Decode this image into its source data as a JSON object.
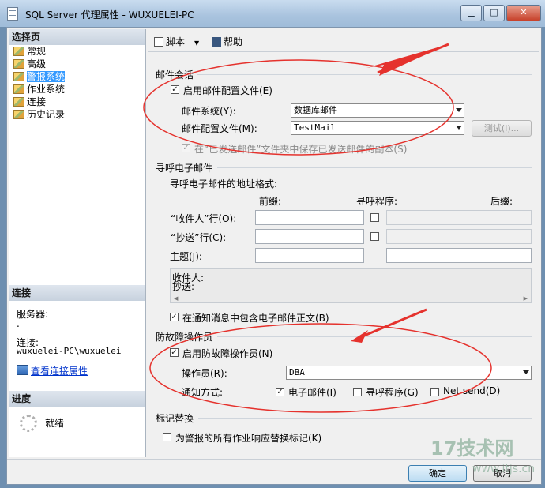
{
  "window": {
    "title": "SQL Server 代理属性 - WUXUELEI-PC",
    "minimize": "▁",
    "maximize": "□",
    "close": "✕"
  },
  "left": {
    "select_page_header": "选择页",
    "pages": [
      {
        "label": "常规"
      },
      {
        "label": "高级"
      },
      {
        "label": "警报系统"
      },
      {
        "label": "作业系统"
      },
      {
        "label": "连接"
      },
      {
        "label": "历史记录"
      }
    ],
    "connection_header": "连接",
    "server_label": "服务器:",
    "server_value": ".",
    "connection_label": "连接:",
    "connection_value": "wuxuelei-PC\\wuxuelei",
    "view_link": "查看连接属性",
    "progress_header": "进度",
    "status": "就绪"
  },
  "toolbar": {
    "script_label": "脚本",
    "help_label": "帮助"
  },
  "mail": {
    "section": "邮件会话",
    "enable_profile": "启用邮件配置文件(E)",
    "system_label": "邮件系统(Y):",
    "system_value": "数据库邮件",
    "profile_label": "邮件配置文件(M):",
    "profile_value": "TestMail",
    "test_button": "测试(I)...",
    "save_copy": "在“已发送邮件”文件夹中保存已发送邮件的副本(S)"
  },
  "pager": {
    "section": "寻呼电子邮件",
    "format_label": "寻呼电子邮件的地址格式:",
    "col_prefix": "前缀:",
    "col_pager": "寻呼程序:",
    "col_suffix": "后缀:",
    "to_label": "“收件人”行(O):",
    "cc_label": "“抄送”行(C):",
    "subject_label": "主题(J):",
    "preview_to": "收件人:",
    "preview_cc": "抄送:",
    "include_body": "在通知消息中包含电子邮件正文(B)"
  },
  "failsafe": {
    "section": "防故障操作员",
    "enable": "启用防故障操作员(N)",
    "operator_label": "操作员(R):",
    "operator_value": "DBA",
    "notify_label": "通知方式:",
    "opt_email": "电子邮件(I)",
    "opt_pager": "寻呼程序(G)",
    "opt_netsend": "Net send(D)"
  },
  "token": {
    "section": "标记替换",
    "replace": "为警报的所有作业响应替换标记(K)"
  },
  "footer": {
    "ok": "确定",
    "cancel": "取消"
  },
  "watermark": {
    "brand": "17技术网",
    "site": "www.itjs.cn"
  }
}
